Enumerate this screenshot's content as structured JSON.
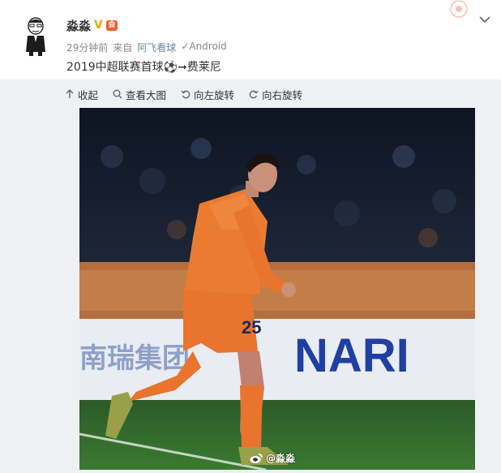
{
  "post": {
    "author": "淼淼",
    "vip_badge": "V",
    "member_badge": "会",
    "timestamp": "29分钟前",
    "source_prefix": "来自",
    "source_app": "阿飞看球",
    "source_client": "✓Android",
    "text": "2019中超联赛首球⚽➞费莱尼"
  },
  "toolbar": {
    "collapse": "收起",
    "view_large": "查看大图",
    "rotate_left": "向左旋转",
    "rotate_right": "向右旋转"
  },
  "photo": {
    "banner_text": "NARI",
    "banner_left_text": "南瑞集团",
    "number": "25",
    "credit": "@淼淼"
  },
  "colors": {
    "jersey": "#e8742e",
    "banner_blue": "#1f3fa3",
    "pitch": "#2f6a2c",
    "link": "#6b85a8"
  },
  "icons": {
    "collapse": "arrow-up-icon",
    "view_large": "magnifier-icon",
    "rotate_left": "rotate-left-icon",
    "rotate_right": "rotate-right-icon",
    "more": "chevron-down-icon"
  }
}
